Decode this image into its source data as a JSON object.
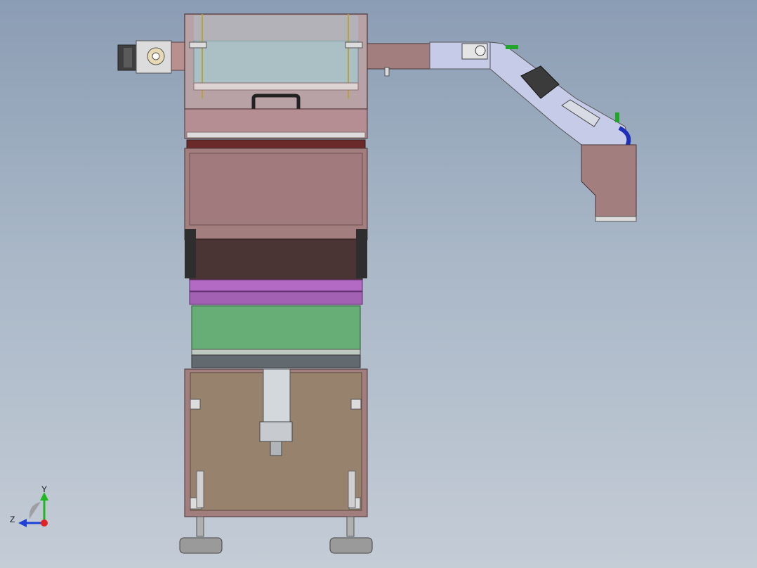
{
  "viewport": {
    "background_top": "#8b9db4",
    "background_bottom": "#c4ccd6"
  },
  "model": {
    "body_color": "#a27e7e",
    "panel_dark": "#4a3434",
    "purple_plate": "#b26ac4",
    "green_panel": "#66ad76",
    "base_panel": "#97836d",
    "arm_color": "#c6cbe8",
    "motor_color": "#3b3b3b",
    "glass_color": "#a9c4c8"
  },
  "triad": {
    "y_label": "Y",
    "z_label": "Z",
    "y_color": "#1fb81f",
    "z_color": "#1d3fd6",
    "x_color": "#e02424"
  }
}
